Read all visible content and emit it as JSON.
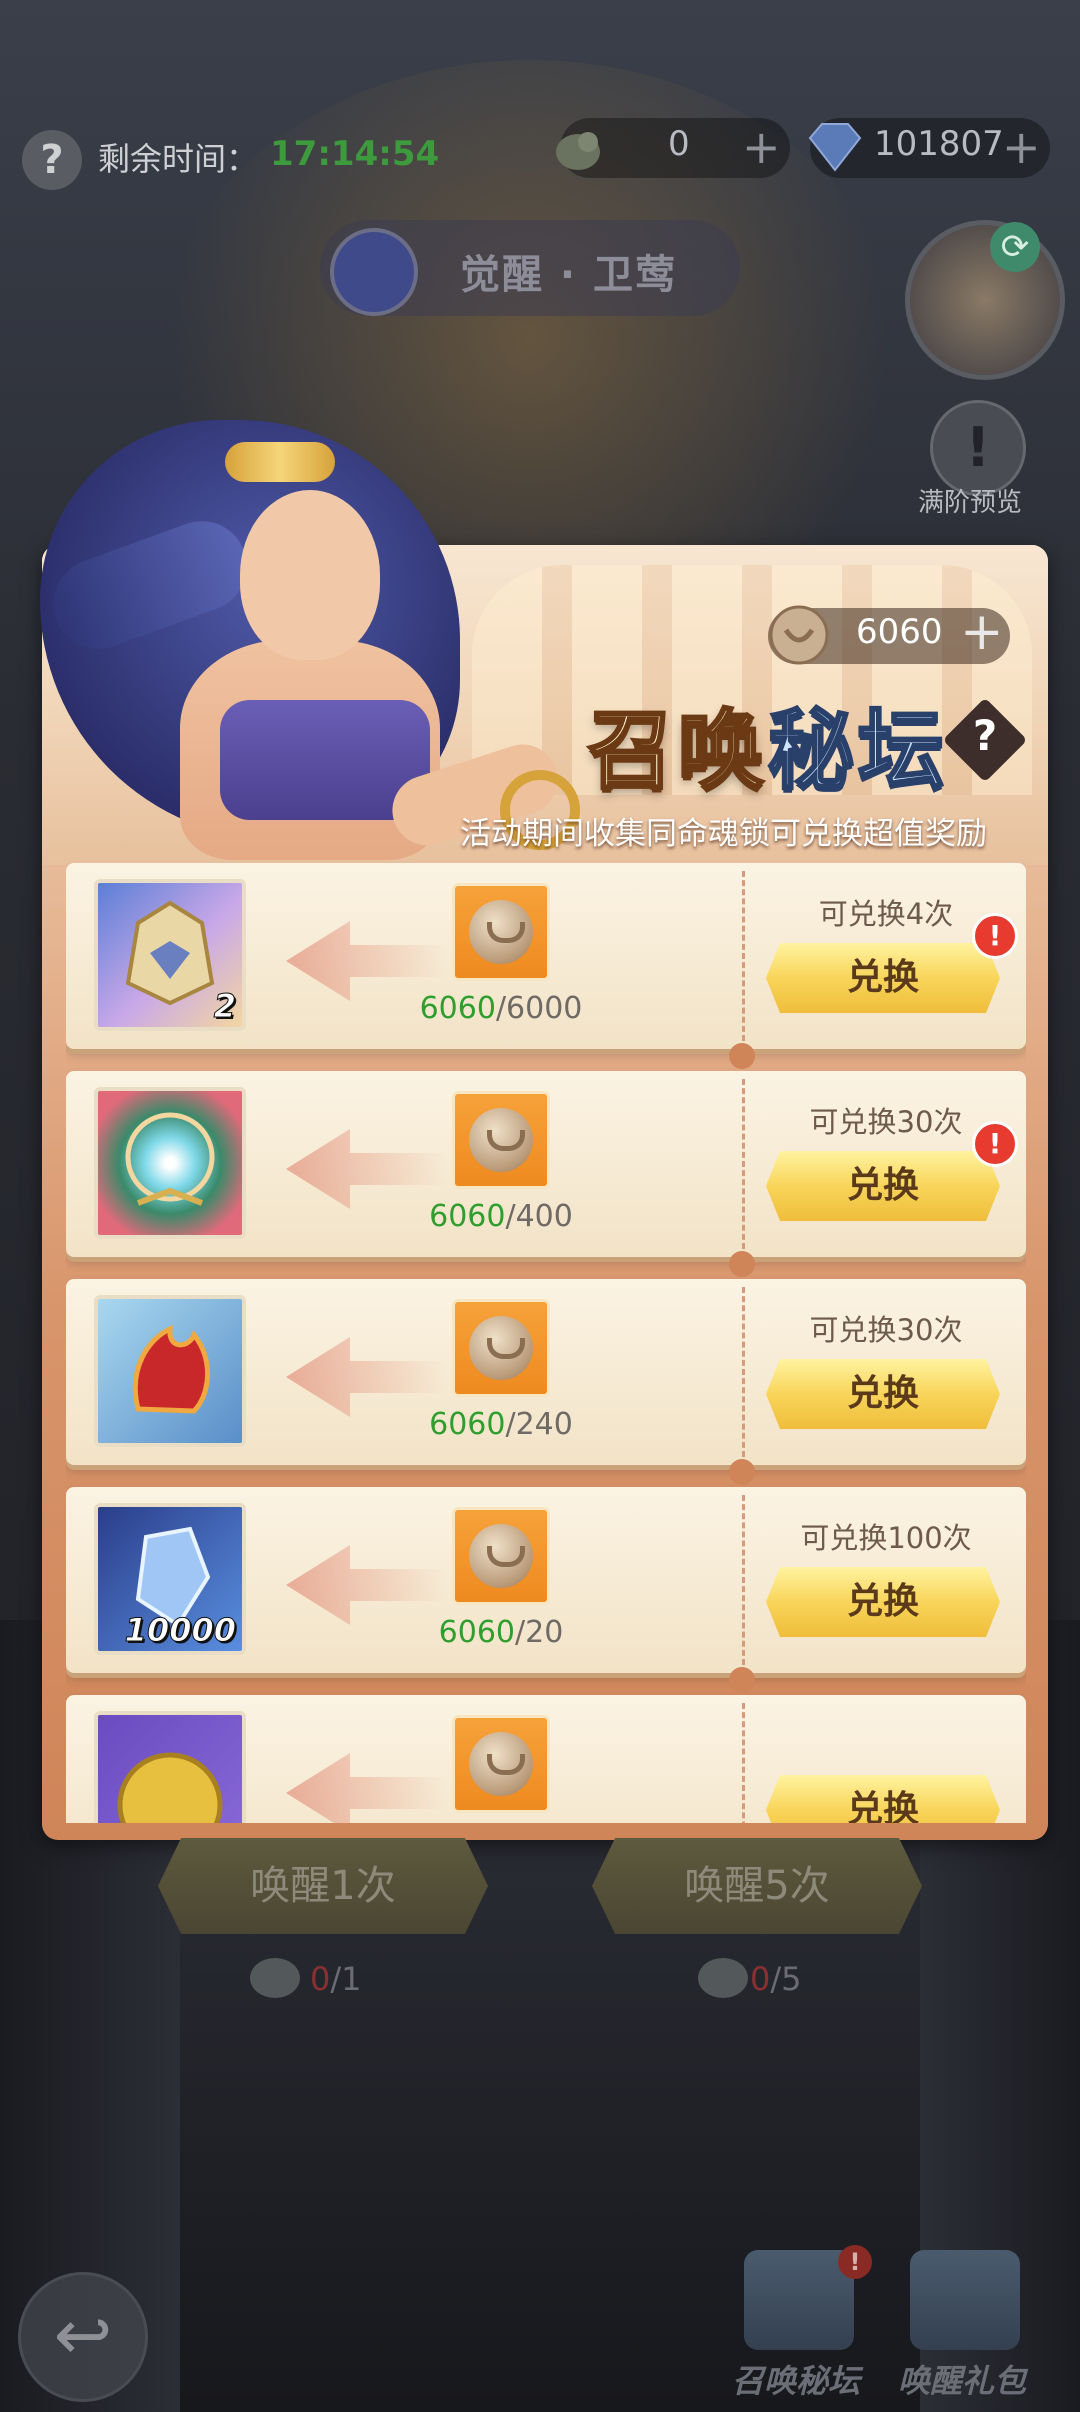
{
  "top_bar": {
    "help_icon": "?",
    "remaining_time_label": "剩余时间：",
    "remaining_time_value": "17:14:54",
    "resource_1_value": "0",
    "resource_2_value": "101807",
    "plus": "+"
  },
  "banner": {
    "title": "觉醒 · 卫莺"
  },
  "side": {
    "full_preview_label": "满阶预览",
    "full_preview_icon": "!"
  },
  "panel": {
    "currency_value": "6060",
    "currency_plus": "+",
    "title_part1": "召唤",
    "title_part2": "秘坛",
    "help": "?",
    "subtitle": "活动期间收集同命魂锁可兑换超值奖励",
    "button_label": "兑换",
    "rows": [
      {
        "reward_icon": "golden-helmet",
        "reward_count": "2",
        "have": "6060",
        "need": "/6000",
        "limit": "可兑换4次",
        "alert": "!"
      },
      {
        "reward_icon": "crystal-orb",
        "reward_count": "",
        "have": "6060",
        "need": "/400",
        "limit": "可兑换30次",
        "alert": "!"
      },
      {
        "reward_icon": "red-phoenix-emblem",
        "reward_count": "",
        "have": "6060",
        "need": "/240",
        "limit": "可兑换30次",
        "alert": ""
      },
      {
        "reward_icon": "blue-crystal",
        "reward_count": "10000",
        "have": "6060",
        "need": "/20",
        "limit": "可兑换100次",
        "alert": ""
      },
      {
        "reward_icon": "gold-coin",
        "reward_count": "",
        "have": "",
        "need": "",
        "limit": "",
        "alert": ""
      }
    ]
  },
  "bottom": {
    "wake_1": "唤醒1次",
    "wake_5": "唤醒5次",
    "wake_1_have": "0",
    "wake_1_need": "/1",
    "wake_5_have": "0",
    "wake_5_need": "/5",
    "back_icon": "↩",
    "nav_summon_altar": "召唤秘坛",
    "nav_awaken_gift": "唤醒礼包",
    "nav_alert": "!"
  },
  "colors": {
    "time_green": "#3d9a3d",
    "have_green": "#2f9e2f",
    "button_gold": "#f8d55a",
    "alert_red": "#e63b2e"
  }
}
